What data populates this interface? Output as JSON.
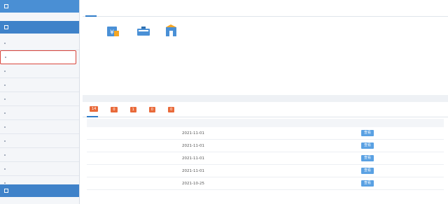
{
  "sidebar": {
    "header_title": "",
    "header_right": "",
    "section1": "",
    "items": [
      {
        "label": ""
      },
      {
        "label": ""
      },
      {
        "label": ""
      },
      {
        "label": ""
      },
      {
        "label": ""
      },
      {
        "label": ""
      },
      {
        "label": ""
      },
      {
        "label": ""
      },
      {
        "label": ""
      },
      {
        "label": ""
      },
      {
        "label": ""
      },
      {
        "label": ""
      },
      {
        "label": ""
      }
    ],
    "section2": ""
  },
  "tabs": [
    "",
    "",
    "",
    "",
    ""
  ],
  "quick_actions": [
    {
      "label": "",
      "icon": "money-card-icon"
    },
    {
      "label": "",
      "icon": "id-card-icon"
    },
    {
      "label": "",
      "icon": "user-manage-icon"
    }
  ],
  "bottom_tabs": [
    {
      "label": "",
      "badge": "14"
    },
    {
      "label": "",
      "badge": "0"
    },
    {
      "label": "",
      "badge": "1"
    },
    {
      "label": "",
      "badge": "0"
    },
    {
      "label": "",
      "badge": "0"
    }
  ],
  "table": {
    "headers": [
      "",
      "",
      "",
      ""
    ],
    "rows": [
      {
        "name": "",
        "date": "2021-11-01",
        "status": "",
        "action": "查看"
      },
      {
        "name": "",
        "date": "2021-11-01",
        "status": "",
        "action": "查看"
      },
      {
        "name": "",
        "date": "2021-11-01",
        "status": "",
        "action": "查看"
      },
      {
        "name": "",
        "date": "2021-11-01",
        "status": "",
        "action": "查看"
      },
      {
        "name": "",
        "date": "2021-10-25",
        "status": "",
        "action": "查看"
      }
    ]
  },
  "colors": {
    "accent": "#2f7cc9",
    "header": "#4a8fd4",
    "badge": "#e96a3a",
    "highlight": "#d9453b"
  }
}
